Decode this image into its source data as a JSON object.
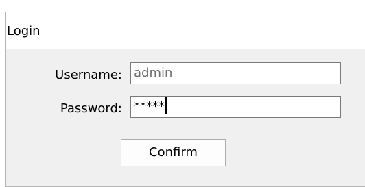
{
  "window": {
    "title": "Login"
  },
  "form": {
    "username_label": "Username:",
    "username_value": "admin",
    "password_label": "Password:",
    "password_value": "*****",
    "confirm_label": "Confirm"
  },
  "colors": {
    "dialog_background": "#f0f0f0",
    "title_background": "#ffffff",
    "input_border": "#7a7a7a",
    "button_border": "#acacac"
  }
}
